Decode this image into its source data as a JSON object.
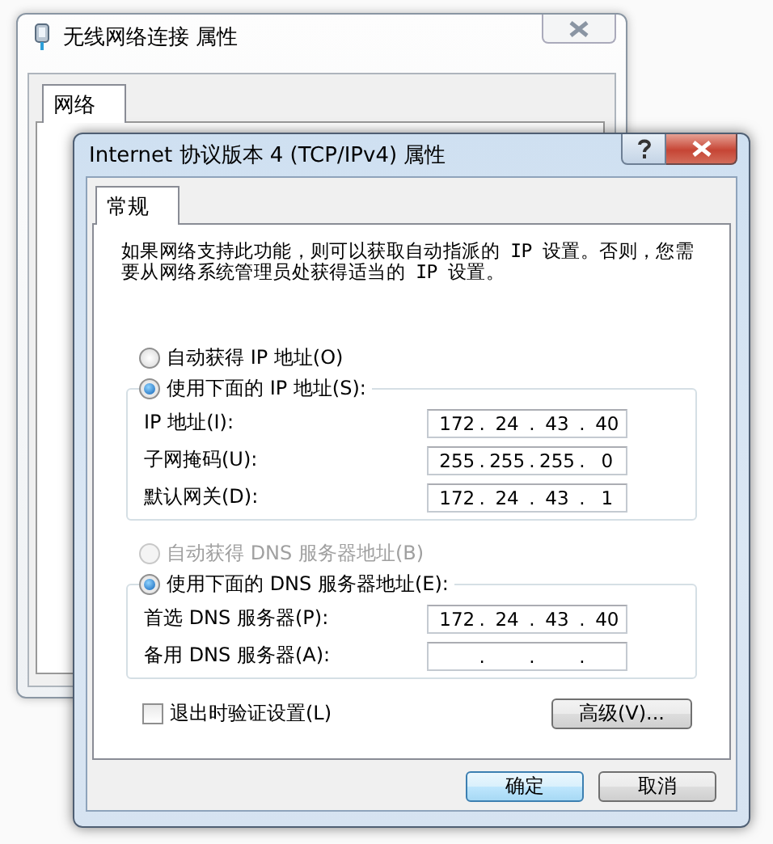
{
  "background_window": {
    "title": "无线网络连接 属性",
    "tabs": [
      {
        "label": "网络",
        "selected": true
      }
    ]
  },
  "dialog": {
    "title": "Internet 协议版本 4 (TCP/IPv4) 属性",
    "tabs": [
      {
        "label": "常规",
        "selected": true
      }
    ],
    "description": "如果网络支持此功能，则可以获取自动指派的 IP 设置。否则，您需要从网络系统管理员处获得适当的 IP 设置。",
    "ip_options": [
      {
        "label": "自动获得 IP 地址(O)",
        "selected": false,
        "disabled": false
      },
      {
        "label": "使用下面的 IP 地址(S):",
        "selected": true,
        "disabled": false
      }
    ],
    "ip_fields": [
      {
        "label": "IP 地址(I):",
        "octets": [
          "172",
          "24",
          "43",
          "40"
        ],
        "dots": [
          ".",
          ".",
          "."
        ]
      },
      {
        "label": "子网掩码(U):",
        "octets": [
          "255",
          "255",
          "255",
          "0"
        ],
        "dots": [
          ".",
          ".",
          "."
        ]
      },
      {
        "label": "默认网关(D):",
        "octets": [
          "172",
          "24",
          "43",
          "1"
        ],
        "dots": [
          ".",
          ".",
          "."
        ]
      }
    ],
    "dns_options": [
      {
        "label": "自动获得 DNS 服务器地址(B)",
        "selected": false,
        "disabled": true
      },
      {
        "label": "使用下面的 DNS 服务器地址(E):",
        "selected": true,
        "disabled": false
      }
    ],
    "dns_fields": [
      {
        "label": "首选 DNS 服务器(P):",
        "octets": [
          "172",
          "24",
          "43",
          "40"
        ],
        "dots": [
          ".",
          ".",
          "."
        ]
      },
      {
        "label": "备用 DNS 服务器(A):",
        "dots": [
          ".",
          ".",
          "."
        ]
      }
    ],
    "validate_checkbox": {
      "label": "退出时验证设置(L)",
      "checked": false
    },
    "advanced_button": "高级(V)...",
    "buttons": [
      {
        "label": "确定",
        "default": true
      },
      {
        "label": "取消",
        "default": false
      }
    ]
  }
}
